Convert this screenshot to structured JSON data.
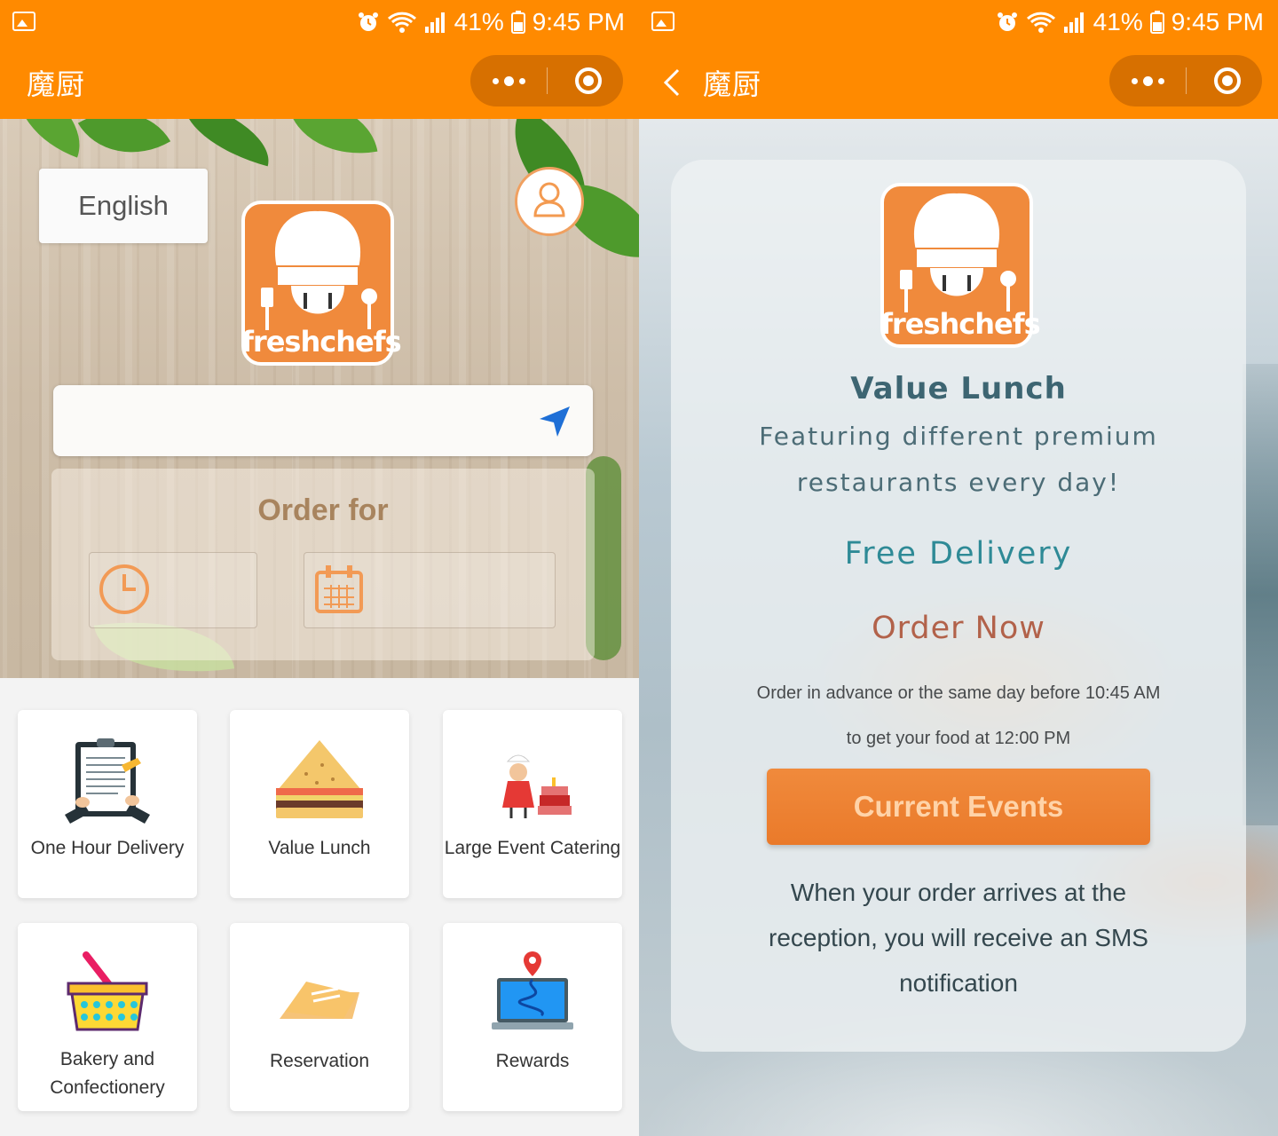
{
  "status_bar": {
    "battery": "41%",
    "time": "9:45 PM"
  },
  "colors": {
    "brand": "#ff8a00",
    "logo_orange": "#f08a3c",
    "teal": "#2e8a96",
    "order_now": "#b2624a"
  },
  "left": {
    "nav": {
      "title": "魔厨"
    },
    "language_button": "English",
    "logo_text": "freshchefs",
    "search": {
      "placeholder": "",
      "icon": "location-arrow-icon"
    },
    "order_panel": {
      "title": "Order for",
      "time_value": "",
      "date_value": ""
    },
    "tiles": [
      {
        "label": "One Hour Delivery",
        "icon": "clipboard-icon"
      },
      {
        "label": "Value Lunch",
        "icon": "sandwich-icon"
      },
      {
        "label": "Large Event Catering",
        "icon": "chef-cake-icon"
      },
      {
        "label": "Bakery and\nConfectionery",
        "icon": "basket-icon"
      },
      {
        "label": "Reservation",
        "icon": "ticket-icon"
      },
      {
        "label": "Rewards",
        "icon": "laptop-map-icon"
      }
    ]
  },
  "right": {
    "nav": {
      "title": "魔厨"
    },
    "logo_text": "freshchefs",
    "title": "Value Lunch",
    "featuring": "Featuring different premium\nrestaurants every day!",
    "free_delivery": "Free Delivery",
    "order_now": "Order Now",
    "advance": "Order in advance or the same day before 10:45 AM\nto get your food at 12:00 PM",
    "events_button": "Current Events",
    "sms": "When your order arrives at the\nreception, you will receive an SMS\nnotification"
  }
}
